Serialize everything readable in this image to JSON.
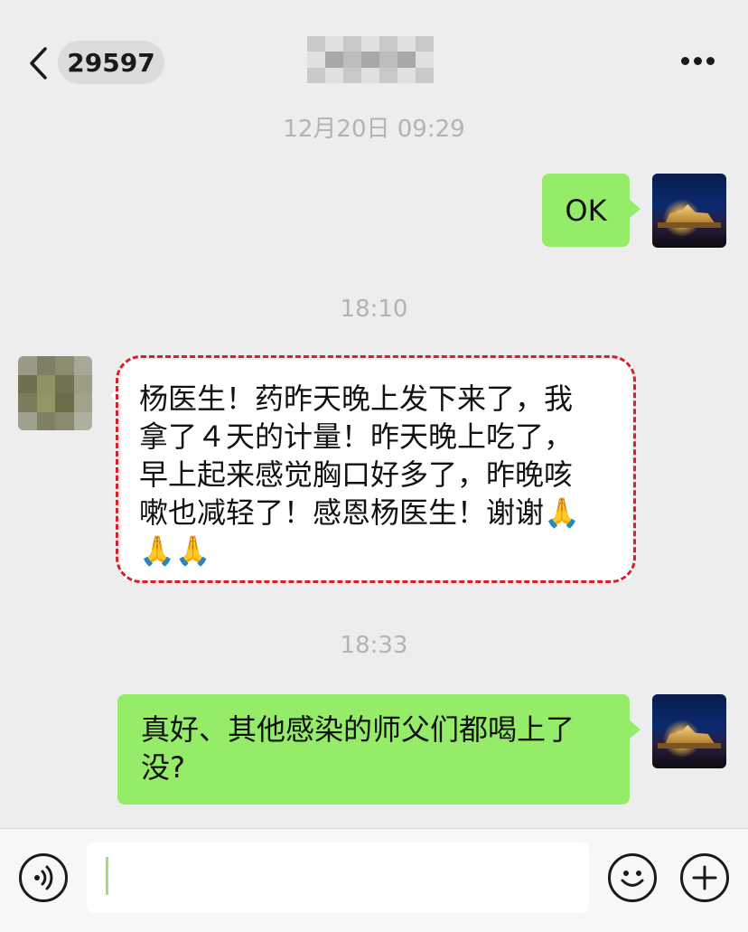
{
  "header": {
    "unread_count": "29597",
    "back_icon": "chevron-left-icon",
    "more_icon": "more-dots-icon"
  },
  "colors": {
    "background": "#ededed",
    "sent_bubble": "#95ec69",
    "received_bubble": "#ffffff",
    "highlight_frame": "#d6202a",
    "timestamp_text": "#b3b3b3"
  },
  "messages": [
    {
      "type": "timestamp",
      "text": "12月20日 09:29"
    },
    {
      "type": "sent",
      "text": "OK",
      "avatar": "temple-night-avatar"
    },
    {
      "type": "timestamp",
      "text": "18:10"
    },
    {
      "type": "received",
      "lines": [
        "杨医生！药昨天晚上发下来了，我",
        "拿了４天的计量！昨天晚上吃了，",
        "早上起来感觉胸口好多了，昨晚咳",
        "嗽也减轻了！感恩杨医生！谢谢🙏",
        "🙏🙏"
      ],
      "avatar": "blurred-avatar",
      "highlighted": true
    },
    {
      "type": "timestamp",
      "text": "18:33"
    },
    {
      "type": "sent",
      "lines": [
        "真好、其他感染的师父们都喝上了",
        "没?"
      ],
      "avatar": "temple-night-avatar"
    }
  ],
  "input_bar": {
    "voice_icon": "voice-icon",
    "emoji_icon": "emoji-icon",
    "plus_icon": "plus-icon",
    "input_value": ""
  }
}
